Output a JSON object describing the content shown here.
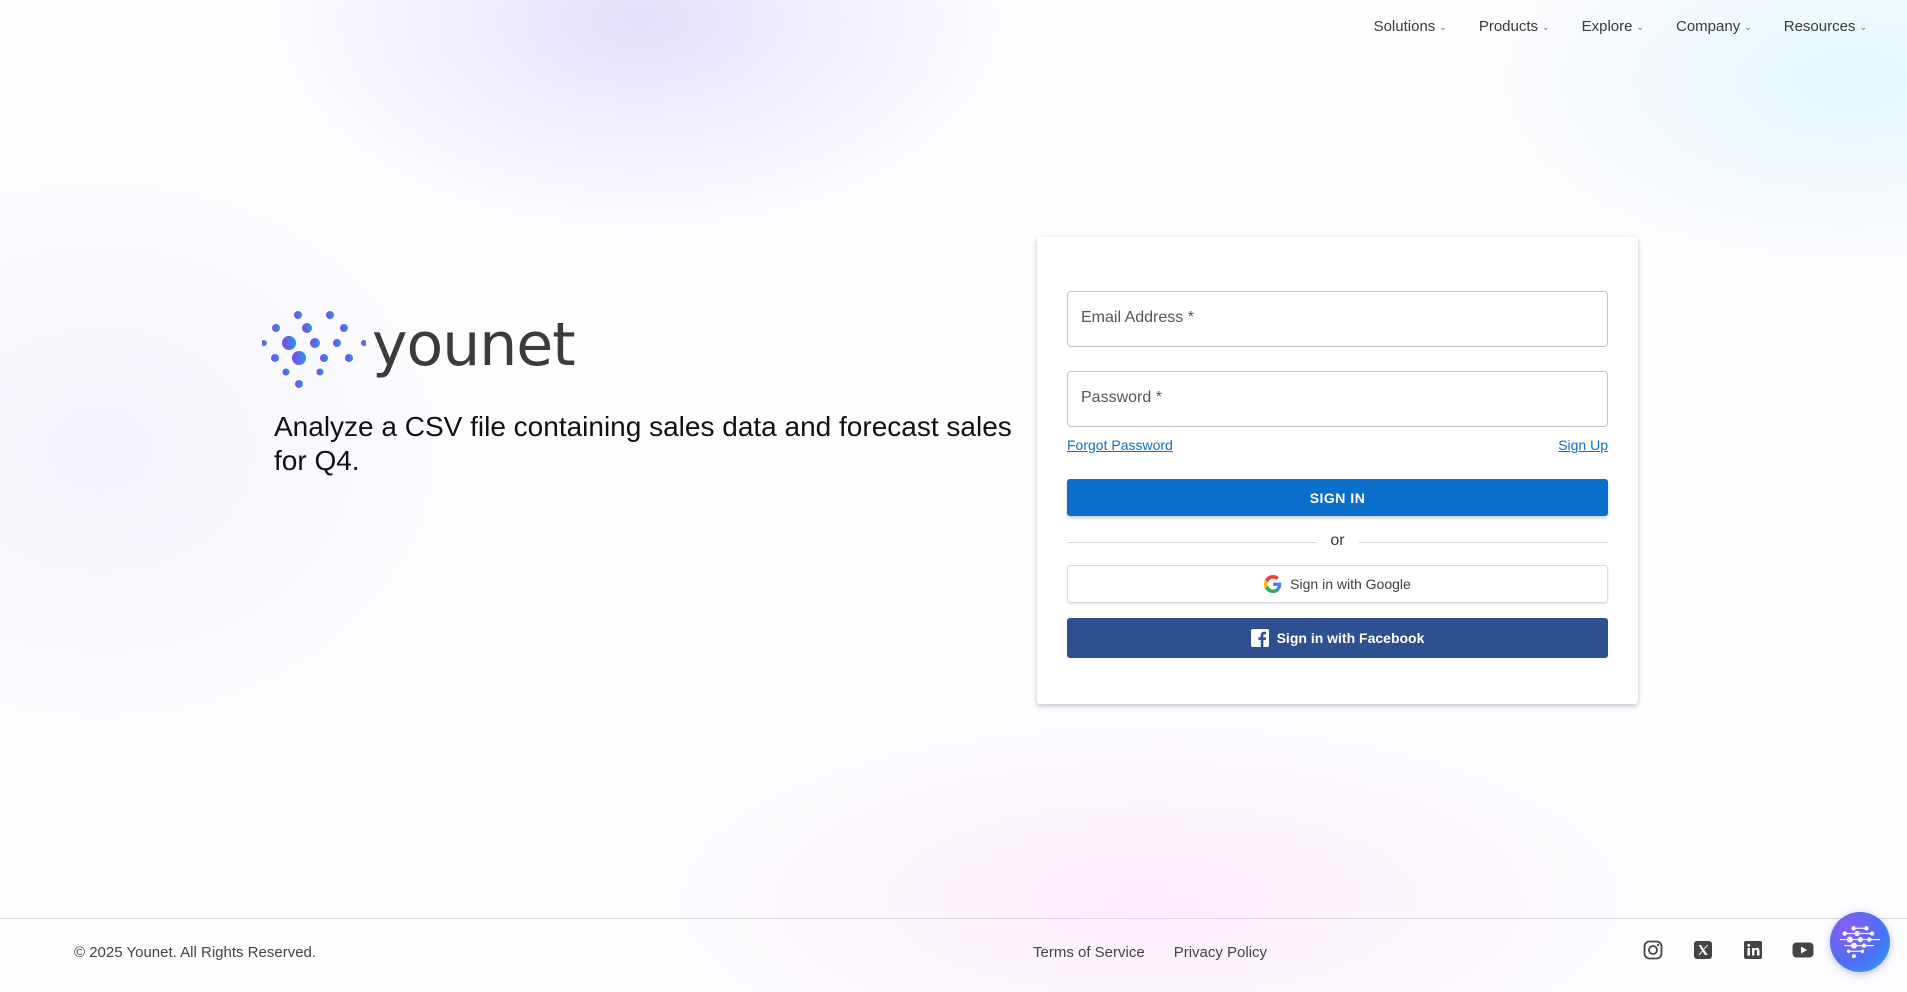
{
  "nav": {
    "items": [
      {
        "label": "Solutions"
      },
      {
        "label": "Products"
      },
      {
        "label": "Explore"
      },
      {
        "label": "Company"
      },
      {
        "label": "Resources"
      }
    ]
  },
  "brand": {
    "name": "younet",
    "tagline": "Analyze a CSV file containing sales data and forecast sales for Q4."
  },
  "signin": {
    "email_label": "Email Address *",
    "password_label": "Password *",
    "forgot_password": "Forgot Password",
    "sign_up": "Sign Up",
    "sign_in_button": "SIGN IN",
    "divider_text": "or",
    "google_button": "Sign in with Google",
    "facebook_button": "Sign in with Facebook"
  },
  "footer": {
    "copyright": "© 2025 Younet. All Rights Reserved.",
    "terms": "Terms of Service",
    "privacy": "Privacy Policy",
    "social": [
      "instagram-icon",
      "x-icon",
      "linkedin-icon",
      "youtube-icon"
    ]
  },
  "colors": {
    "primary": "#0a6ecb",
    "facebook": "#2f5090",
    "link": "#0b6fcd"
  }
}
